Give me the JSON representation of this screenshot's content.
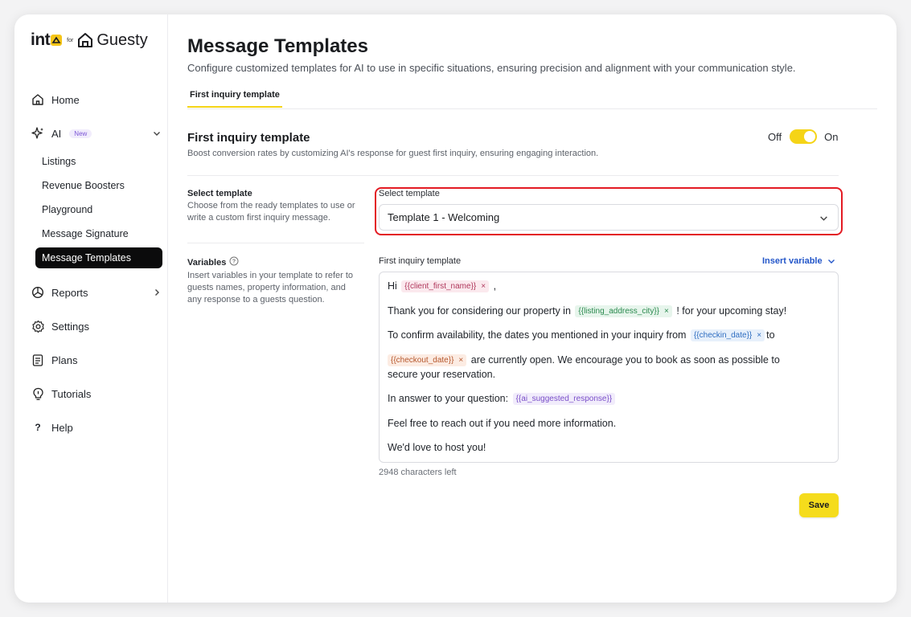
{
  "brand": {
    "into": "int",
    "for": "for",
    "guesty": "Guesty"
  },
  "sidebar": {
    "items": [
      {
        "label": "Home",
        "icon": "home-icon"
      },
      {
        "label": "AI",
        "icon": "sparkle-icon",
        "badge": "New"
      },
      {
        "label": "Reports",
        "icon": "pie-chart-icon"
      },
      {
        "label": "Settings",
        "icon": "gear-icon"
      },
      {
        "label": "Plans",
        "icon": "clipboard-icon"
      },
      {
        "label": "Tutorials",
        "icon": "lightbulb-icon"
      },
      {
        "label": "Help",
        "icon": "question-icon"
      }
    ],
    "ai_subitems": [
      "Listings",
      "Revenue Boosters",
      "Playground",
      "Message Signature",
      "Message Templates"
    ],
    "active_subitem": "Message Templates"
  },
  "page": {
    "title": "Message Templates",
    "subtitle": "Configure customized templates for AI to use in specific situations, ensuring precision and alignment with your communication style.",
    "tabs": [
      "First inquiry template"
    ]
  },
  "section": {
    "title": "First inquiry template",
    "description": "Boost conversion rates by customizing AI's response for guest first inquiry, ensuring engaging interaction.",
    "toggle_off": "Off",
    "toggle_on": "On",
    "toggle_state": "on"
  },
  "select_template": {
    "label": "Select template",
    "description": "Choose from the ready templates to use or write a custom first inquiry message.",
    "field_label": "Select template",
    "value": "Template 1 - Welcoming"
  },
  "variables": {
    "label": "Variables",
    "description": "Insert variables in your template to refer to guests names, property information, and any response to a guests question.",
    "editor_label": "First inquiry template",
    "insert_variable": "Insert variable"
  },
  "editor": {
    "line1_text": "Hi",
    "line1_chip": "{{client_first_name}}",
    "line1_after": ",",
    "line2_before": "Thank you for considering our property in",
    "line2_chip": "{{listing_address_city}}",
    "line2_after": "! for your upcoming stay!",
    "line3_before": "To confirm availability, the dates you mentioned in your inquiry from",
    "line3_chip": "{{checkin_date}}",
    "line3_after": "to",
    "line4_chip": "{{checkout_date}}",
    "line4_after": "are currently open. We encourage you to book as soon as possible to",
    "line5": "secure your reservation.",
    "line6_before": "In answer to your question:",
    "line6_chip": "{{ai_suggested_response}}",
    "line7": "Feel free to reach out if you need more information.",
    "line8": "We'd love to host you!",
    "chip_remove": "×"
  },
  "chars_left": "2948 characters left",
  "save_label": "Save",
  "colors": {
    "accent_yellow": "#f5d417",
    "highlight_red": "#e31b23",
    "link_blue": "#2356c9"
  }
}
